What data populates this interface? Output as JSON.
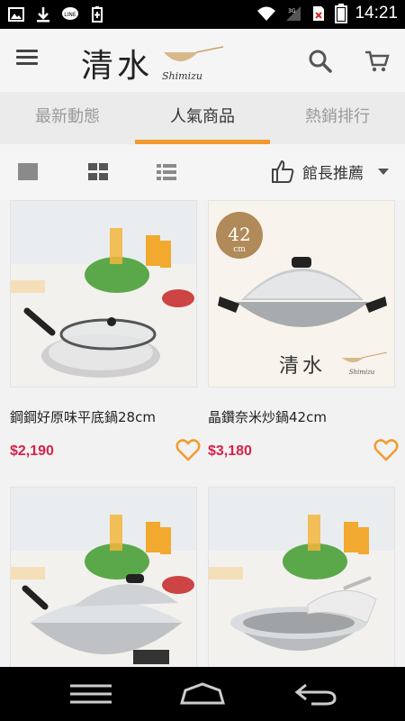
{
  "status_bar": {
    "time": "14:21",
    "left_icons": [
      "image-icon",
      "download-icon",
      "line-app-icon",
      "battery-saver-icon"
    ],
    "right_icons": [
      "wifi-icon",
      "signal-icon",
      "no-sim-icon",
      "battery-icon"
    ]
  },
  "app": {
    "logo_text": "清水",
    "logo_sub": "Shimizu",
    "menu_icon": "hamburger-menu-icon",
    "search_icon": "search-icon",
    "cart_icon": "cart-icon"
  },
  "tabs": [
    {
      "label": "最新動態",
      "active": false
    },
    {
      "label": "人氣商品",
      "active": true
    },
    {
      "label": "熱銷排行",
      "active": false
    }
  ],
  "toolbar": {
    "view_options": [
      "single-view-icon",
      "grid-view-icon",
      "list-view-icon"
    ],
    "sort_label": "館長推薦",
    "sort_icon": "thumbs-up-icon"
  },
  "products": [
    {
      "name": "鋼鋼好原味平底鍋28cm",
      "price": "$2,190",
      "image": "frying-pan-with-lid"
    },
    {
      "name": "晶鑽奈米炒鍋42cm",
      "price": "$3,180",
      "image": "wok-with-lid",
      "badge_number": "42",
      "badge_unit": "cm",
      "watermark": "清水",
      "watermark_sub": "Shimizu"
    },
    {
      "name": "",
      "price": "",
      "image": "wok-with-glass-lid"
    },
    {
      "name": "",
      "price": "",
      "image": "deep-pot-with-lid"
    }
  ],
  "nav": {
    "recents_icon": "recents-icon",
    "home_icon": "home-icon",
    "back_icon": "back-icon"
  },
  "colors": {
    "accent": "#f39a2f",
    "price": "#d6224a",
    "heart": "#f39a2f"
  }
}
